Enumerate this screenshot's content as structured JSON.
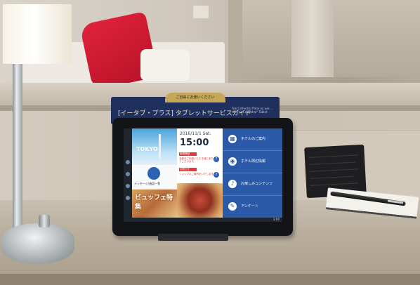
{
  "card": {
    "tab_text": "ご自由にお使いください",
    "title": "[イータブ・プラス] タブレットサービスガイド",
    "subtitle": "Fire Cathedral  Price no use ... the \"ea Cathedral\" Tablet"
  },
  "tablet": {
    "city_label": "TOKYO",
    "message_label": "メッセージ/施設一覧",
    "food_label": "ビュッフェ特集",
    "date": "2016/11/1 Sat.",
    "time": "15:00",
    "notice_1": "新着情報",
    "notice_1_text": "当館をご利用いただき誠にありがとうございます。",
    "notice_2": "お知らせ",
    "notice_2_text": "ショップのご案内をいたします。",
    "bottom_time": "3:00",
    "menu": [
      {
        "icon": "hotel-icon",
        "glyph": "▦",
        "label": "ホテルのご案内"
      },
      {
        "icon": "map-pin-icon",
        "glyph": "◉",
        "label": "ホテル周辺情報"
      },
      {
        "icon": "music-icon",
        "glyph": "♪",
        "label": "お楽しみコンテンツ"
      },
      {
        "icon": "clipboard-icon",
        "glyph": "✎",
        "label": "アンケート"
      }
    ]
  },
  "colors": {
    "menu_blue": "#2a5aa8",
    "card_navy": "#1f2f5e",
    "card_gold": "#c6a758",
    "pillow_red": "#d11e33"
  }
}
